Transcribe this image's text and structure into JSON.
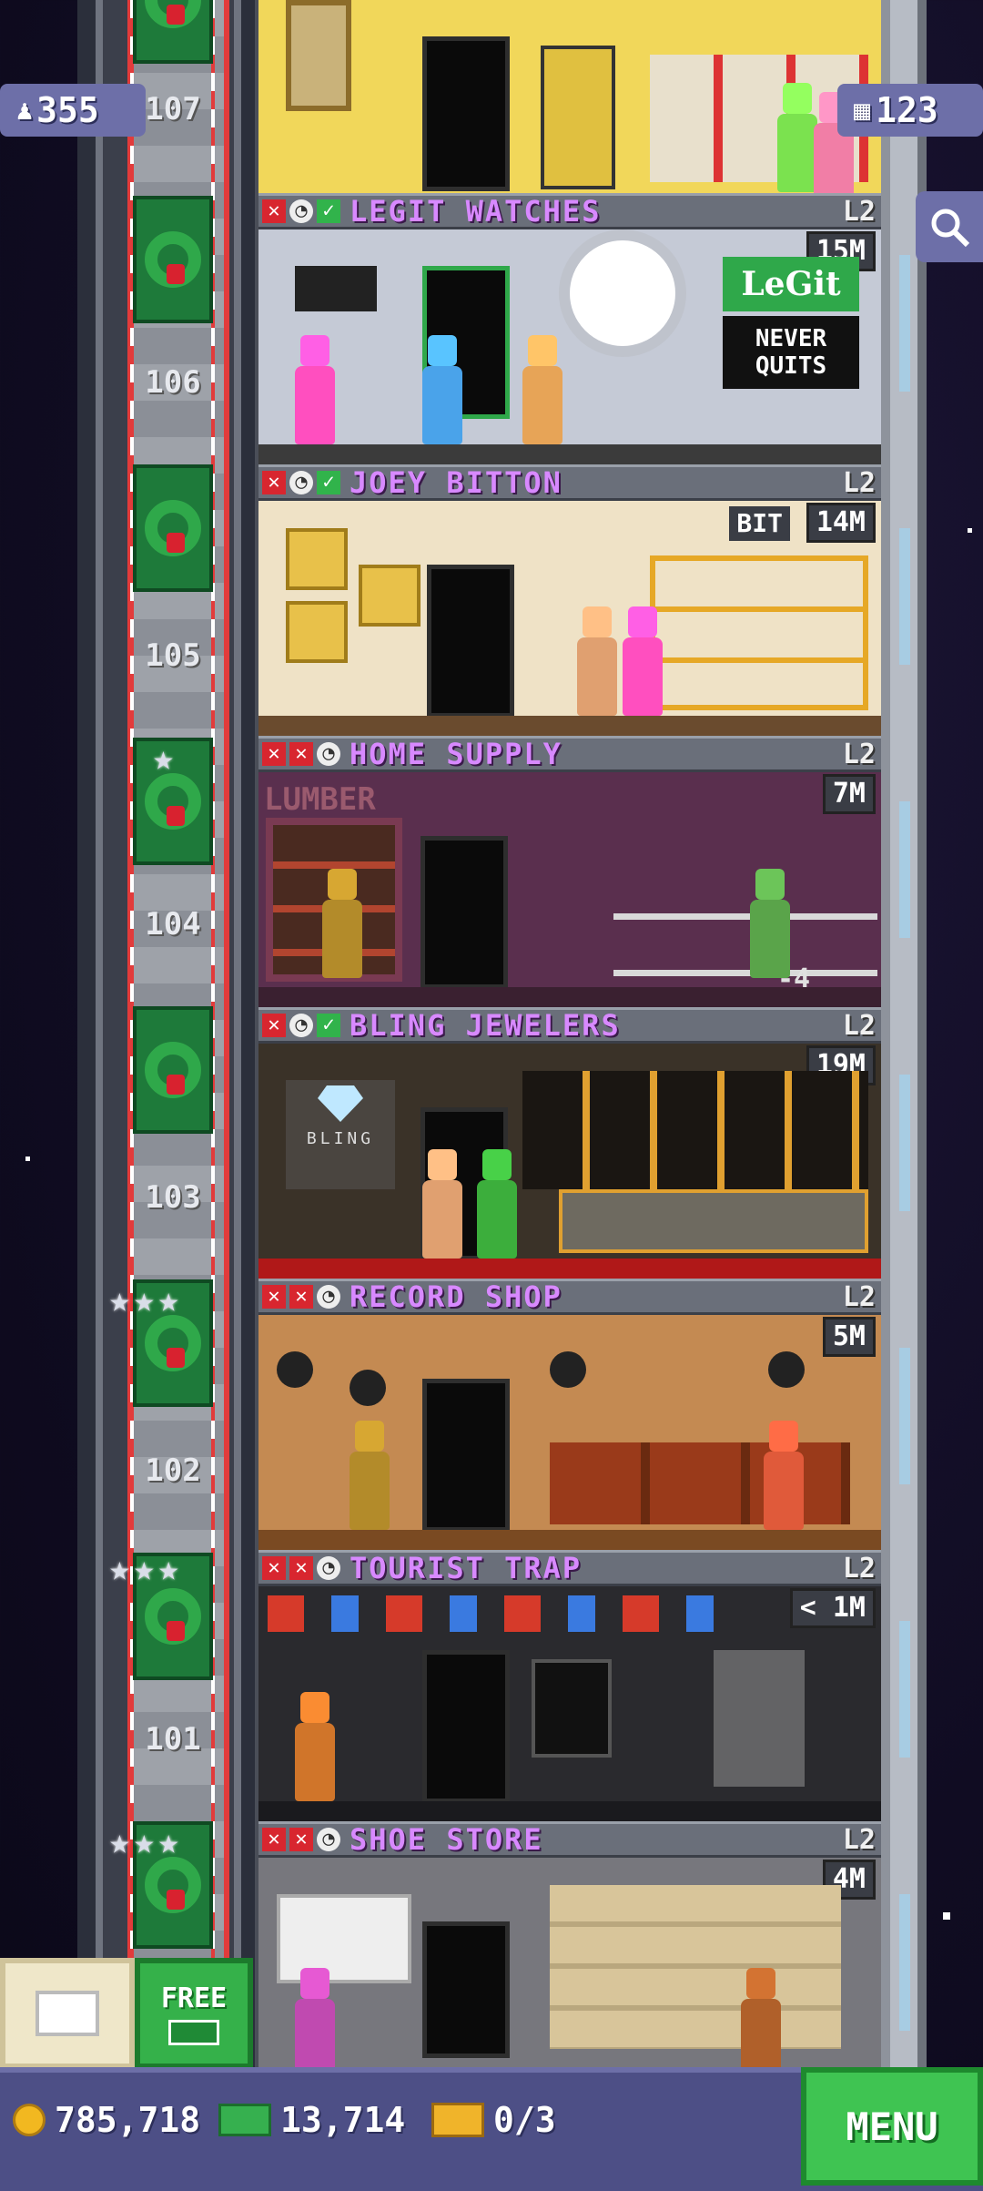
{
  "hud": {
    "residents": "355",
    "floors": "123"
  },
  "elevator": {
    "floor_labels": [
      "107",
      "106",
      "105",
      "104",
      "103",
      "102",
      "101"
    ]
  },
  "floors": [
    {
      "name": "LEGIT WATCHES",
      "level": "L2",
      "money": "15M",
      "status": [
        "x",
        "clock",
        "check"
      ],
      "sign_1": "LeGit",
      "sign_2": "NEVER",
      "sign_3": "QUITS"
    },
    {
      "name": "JOEY BITTON",
      "level": "L2",
      "money": "14M",
      "status": [
        "x",
        "clock",
        "check"
      ],
      "sign_1": "BIT"
    },
    {
      "name": "HOME SUPPLY",
      "level": "L2",
      "money": "7M",
      "status": [
        "x",
        "x",
        "clock"
      ],
      "sign_1": "LUMBER",
      "tip": "-4"
    },
    {
      "name": "BLING JEWELERS",
      "level": "L2",
      "money": "19M",
      "status": [
        "x",
        "clock",
        "check"
      ],
      "sign_1": "BLING"
    },
    {
      "name": "RECORD SHOP",
      "level": "L2",
      "money": "5M",
      "status": [
        "x",
        "x",
        "clock"
      ]
    },
    {
      "name": "TOURIST TRAP",
      "level": "L2",
      "money": "< 1M",
      "status": [
        "x",
        "x",
        "clock"
      ]
    },
    {
      "name": "SHOE STORE",
      "level": "L2",
      "money": "4M",
      "status": [
        "x",
        "x",
        "clock"
      ]
    }
  ],
  "bottom": {
    "coins": "785,718",
    "bux": "13,714",
    "tickets": "0/3",
    "free_label": "FREE",
    "menu_label": "MENU"
  },
  "colors": {
    "floor_name": "#d889ff",
    "menu": "#3fc452",
    "hud_pill": "#6d6fa8"
  }
}
